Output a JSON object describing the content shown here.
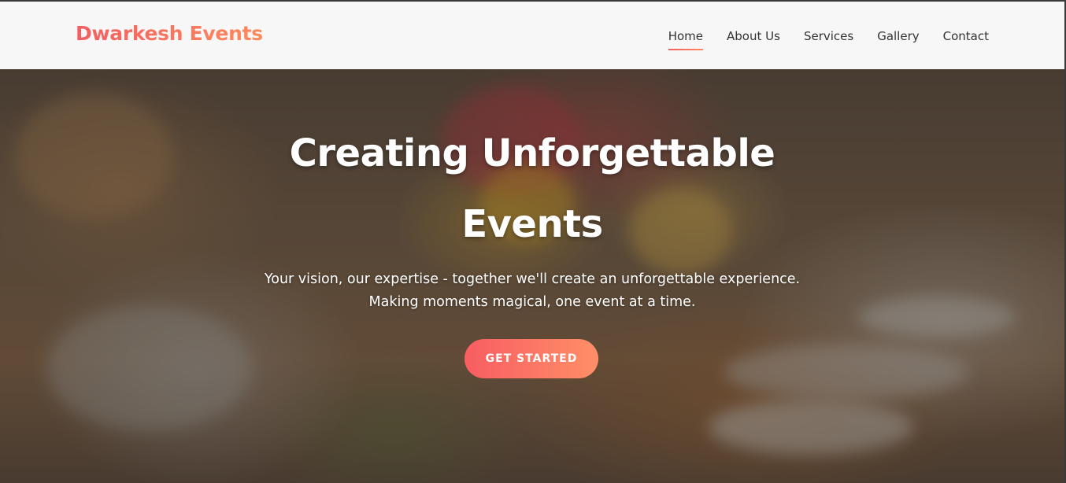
{
  "brand": {
    "name": "Dwarkesh Events"
  },
  "nav": {
    "items": [
      {
        "label": "Home",
        "active": true
      },
      {
        "label": "About Us",
        "active": false
      },
      {
        "label": "Services",
        "active": false
      },
      {
        "label": "Gallery",
        "active": false
      },
      {
        "label": "Contact",
        "active": false
      }
    ]
  },
  "hero": {
    "title": "Creating Unforgettable Events",
    "subtitle": "Your vision, our expertise - together we'll create an unforgettable experience. Making moments magical, one event at a time.",
    "cta_label": "GET STARTED"
  },
  "colors": {
    "accent_start": "#f25f62",
    "accent_end": "#ff8a5b",
    "nav_text": "#333333",
    "header_bg": "#f7f7f7"
  }
}
